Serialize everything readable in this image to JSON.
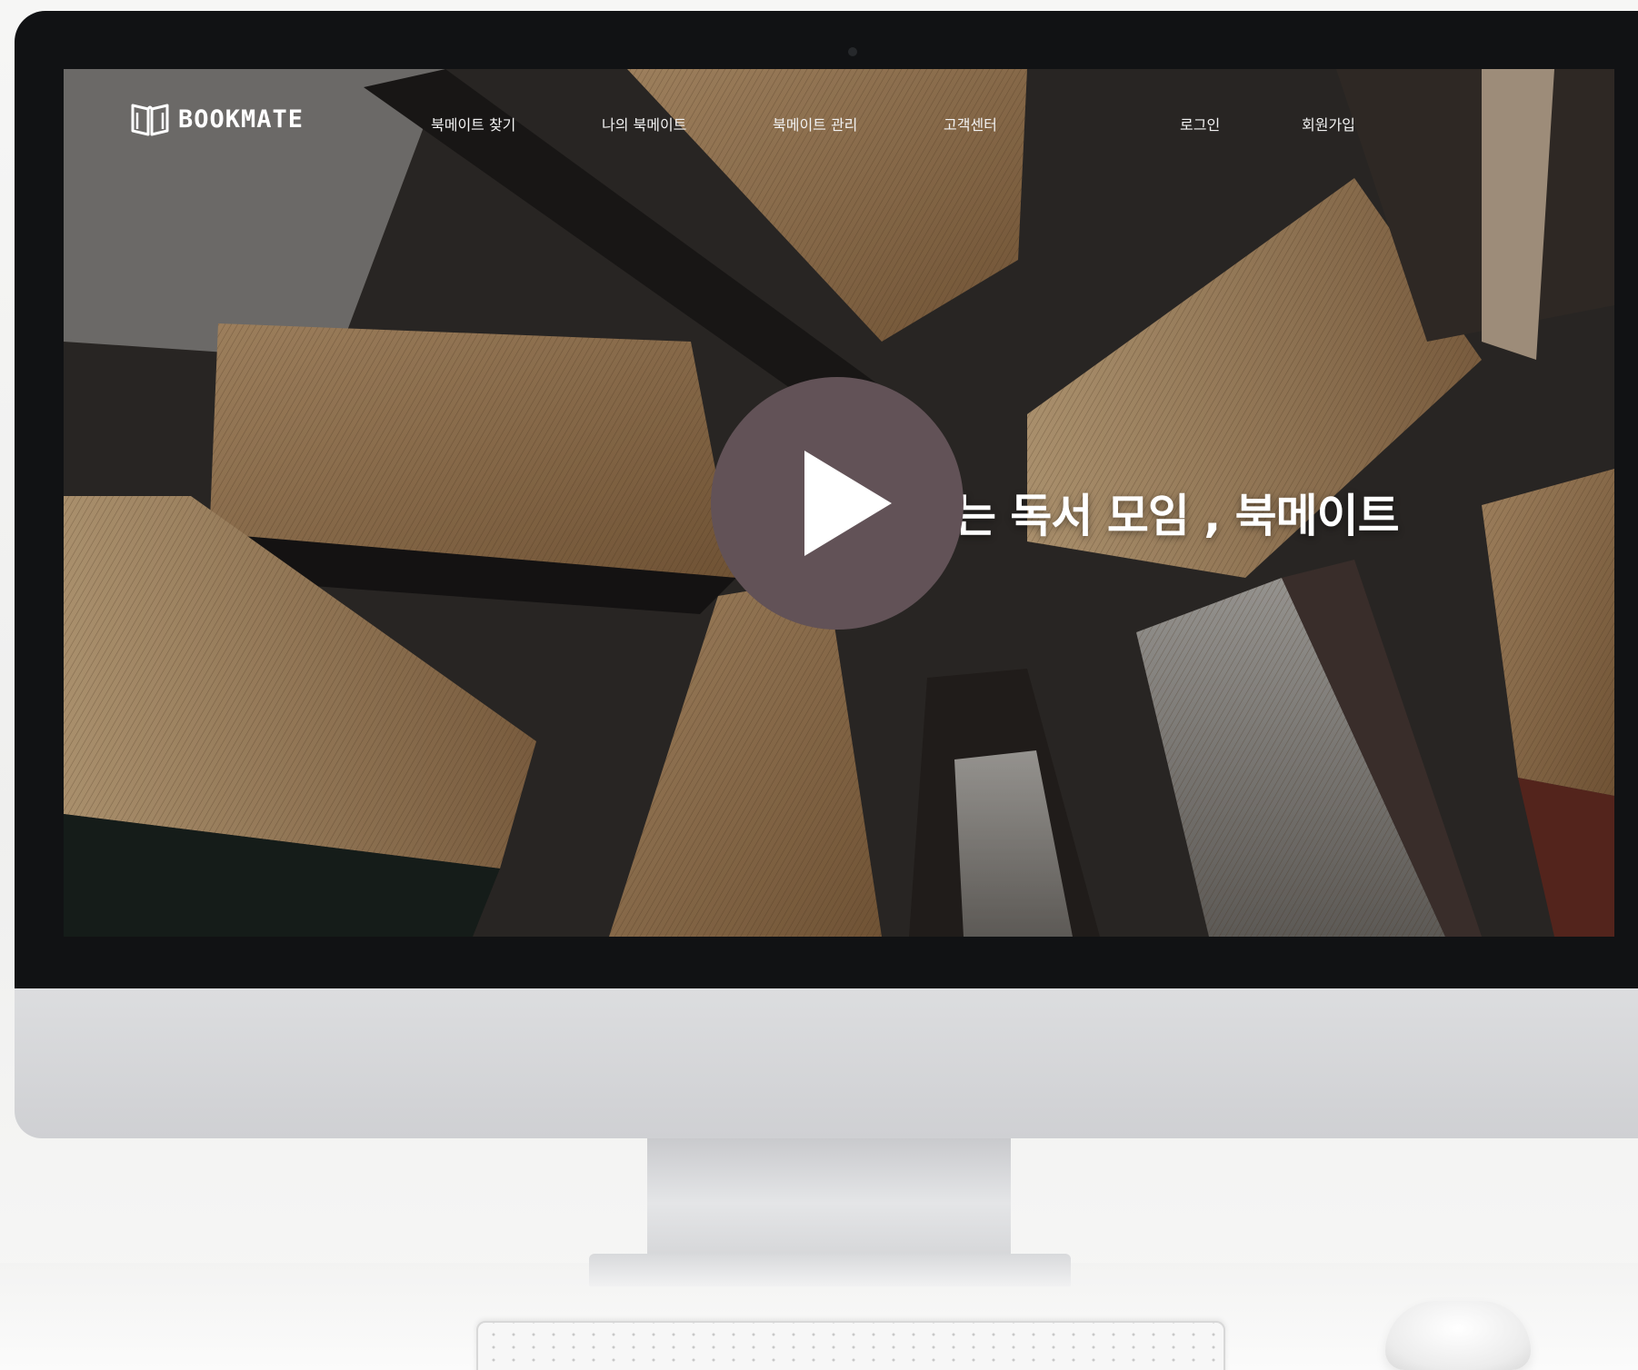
{
  "site": {
    "brand": "BOOKMATE",
    "logo_icon": "open-book-icon"
  },
  "nav": {
    "items": [
      {
        "label": "북메이트 찾기"
      },
      {
        "label": "나의 북메이트"
      },
      {
        "label": "북메이트 관리"
      },
      {
        "label": "고객센터"
      }
    ],
    "login_label": "로그인",
    "signup_label": "회원가입"
  },
  "hero": {
    "title": "는 독서 모임 , 북메이트",
    "play_icon": "play-icon",
    "play_button_color": "#625257"
  }
}
